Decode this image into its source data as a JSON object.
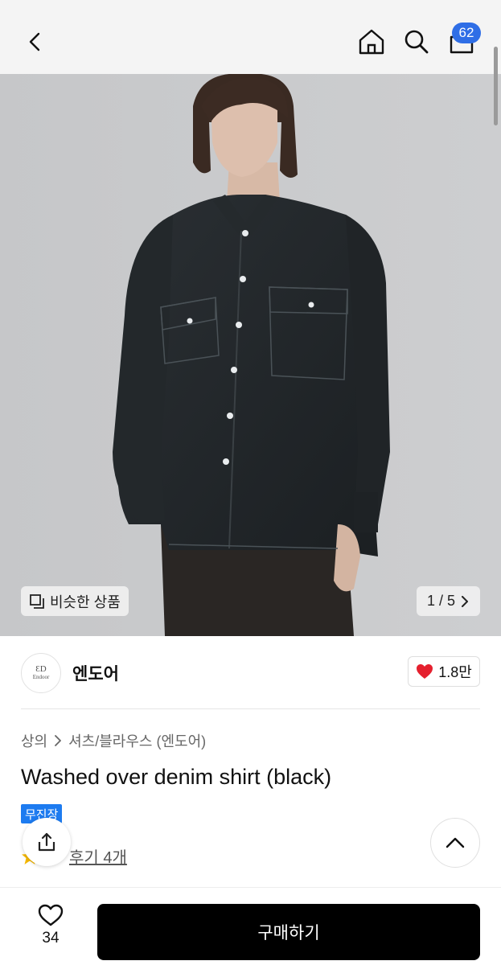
{
  "header": {
    "cart_count": "62",
    "icons": [
      "back-arrow-icon",
      "home-icon",
      "search-icon",
      "shopping-bag-icon"
    ]
  },
  "gallery": {
    "similar_label": "비슷한 상품",
    "page_indicator": "1 / 5"
  },
  "brand": {
    "logo_mark": "ƐD",
    "logo_text": "Endoor",
    "name": "엔도어",
    "like_count": "1.8만"
  },
  "product": {
    "breadcrumb": [
      "상의",
      "셔츠/블라우스 (엔도어)"
    ],
    "title": "Washed over denim shirt (black)",
    "badge": "무진장",
    "review_label": "후기 4개"
  },
  "footer": {
    "wish_count": "34",
    "buy_label": "구매하기"
  },
  "colors": {
    "accent_blue": "#2f6ee6",
    "badge_blue": "#1d7bf0",
    "heart_red": "#e5202e",
    "buy_button": "#000000"
  }
}
